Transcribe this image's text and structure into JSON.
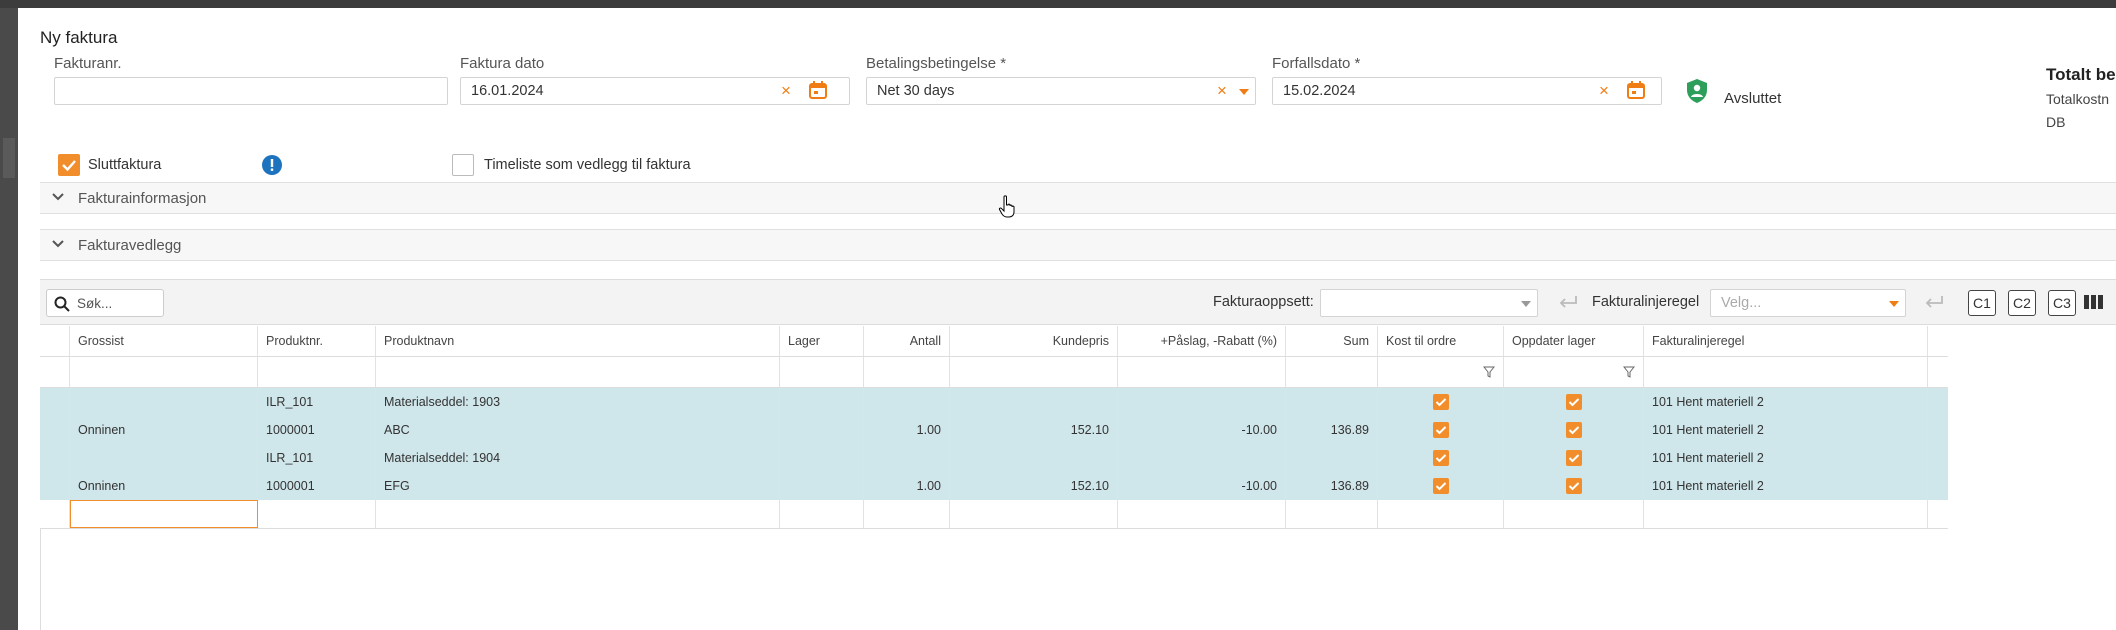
{
  "form": {
    "title": "Ny faktura",
    "invoice_no_label": "Fakturanr.",
    "invoice_no_value": "",
    "invoice_date_label": "Faktura dato",
    "invoice_date_value": "16.01.2024",
    "payment_terms_label": "Betalingsbetingelse *",
    "payment_terms_value": "Net 30 days",
    "due_date_label": "Forfallsdato *",
    "due_date_value": "15.02.2024",
    "status_label": "Avsluttet",
    "totals_title": "Totalt be",
    "totals_row1": "Totalkostn",
    "totals_row2": "DB",
    "final_invoice_label": "Sluttfaktura",
    "final_invoice_checked": true,
    "timesheet_label": "Timeliste som vedlegg til faktura",
    "timesheet_checked": false
  },
  "sections": [
    {
      "label": "Fakturainformasjon"
    },
    {
      "label": "Fakturavedlegg"
    }
  ],
  "toolbar": {
    "search_placeholder": "Søk...",
    "invoice_setup_label": "Fakturaoppsett:",
    "invoice_setup_value": "",
    "line_rule_label": "Fakturalinjeregel",
    "line_rule_placeholder": "Velg...",
    "c1": "C1",
    "c2": "C2",
    "c3": "C3"
  },
  "grid": {
    "columns": [
      "Grossist",
      "Produktnr.",
      "Produktnavn",
      "Lager",
      "Antall",
      "Kundepris",
      "+Påslag, -Rabatt (%)",
      "Sum",
      "Kost til ordre",
      "Oppdater lager",
      "Fakturalinjeregel"
    ],
    "rows": [
      {
        "grossist": "",
        "produktnr": "ILR_101",
        "produktnavn": "Materialseddel: 1903",
        "lager": "",
        "antall": "",
        "kundepris": "",
        "paslag": "",
        "sum": "",
        "kost": true,
        "oppdater": true,
        "regel": "101 Hent materiell 2"
      },
      {
        "grossist": "Onninen",
        "produktnr": "1000001",
        "produktnavn": "ABC",
        "lager": "",
        "antall": "1.00",
        "kundepris": "152.10",
        "paslag": "-10.00",
        "sum": "136.89",
        "kost": true,
        "oppdater": true,
        "regel": "101 Hent materiell 2"
      },
      {
        "grossist": "",
        "produktnr": "ILR_101",
        "produktnavn": "Materialseddel: 1904",
        "lager": "",
        "antall": "",
        "kundepris": "",
        "paslag": "",
        "sum": "",
        "kost": true,
        "oppdater": true,
        "regel": "101 Hent materiell 2"
      },
      {
        "grossist": "Onninen",
        "produktnr": "1000001",
        "produktnavn": "EFG",
        "lager": "",
        "antall": "1.00",
        "kundepris": "152.10",
        "paslag": "-10.00",
        "sum": "136.89",
        "kost": true,
        "oppdater": true,
        "regel": "101 Hent materiell 2"
      }
    ]
  },
  "colors": {
    "accent": "#f28d2b",
    "row_highlight": "#cfe6ea",
    "info_blue": "#1e73be",
    "shield_green": "#2e9e5b"
  }
}
